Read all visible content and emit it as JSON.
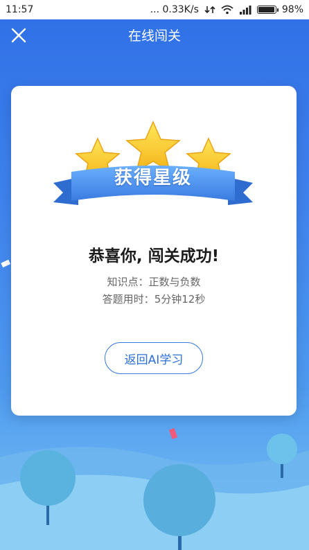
{
  "status_bar": {
    "time": "11:57",
    "network_speed": "... 0.33K/s",
    "battery_percent_text": "98%",
    "battery_level": 0.98
  },
  "header": {
    "title": "在线闯关",
    "close_icon": "close-icon"
  },
  "result_card": {
    "badge_label": "获得星级",
    "stars_earned": 3,
    "stars_total": 3,
    "headline": "恭喜你, 闯关成功!",
    "knowledge_point_label": "知识点：",
    "knowledge_point_value": "正数与负数",
    "time_used_label": "答题用时：",
    "time_used_value": "5分钟12秒",
    "return_button_label": "返回AI学习"
  },
  "colors": {
    "background_top": "#2f6fe6",
    "accent": "#3a7bdc",
    "star": "#f7c71d",
    "ribbon": "#4a93ee"
  }
}
